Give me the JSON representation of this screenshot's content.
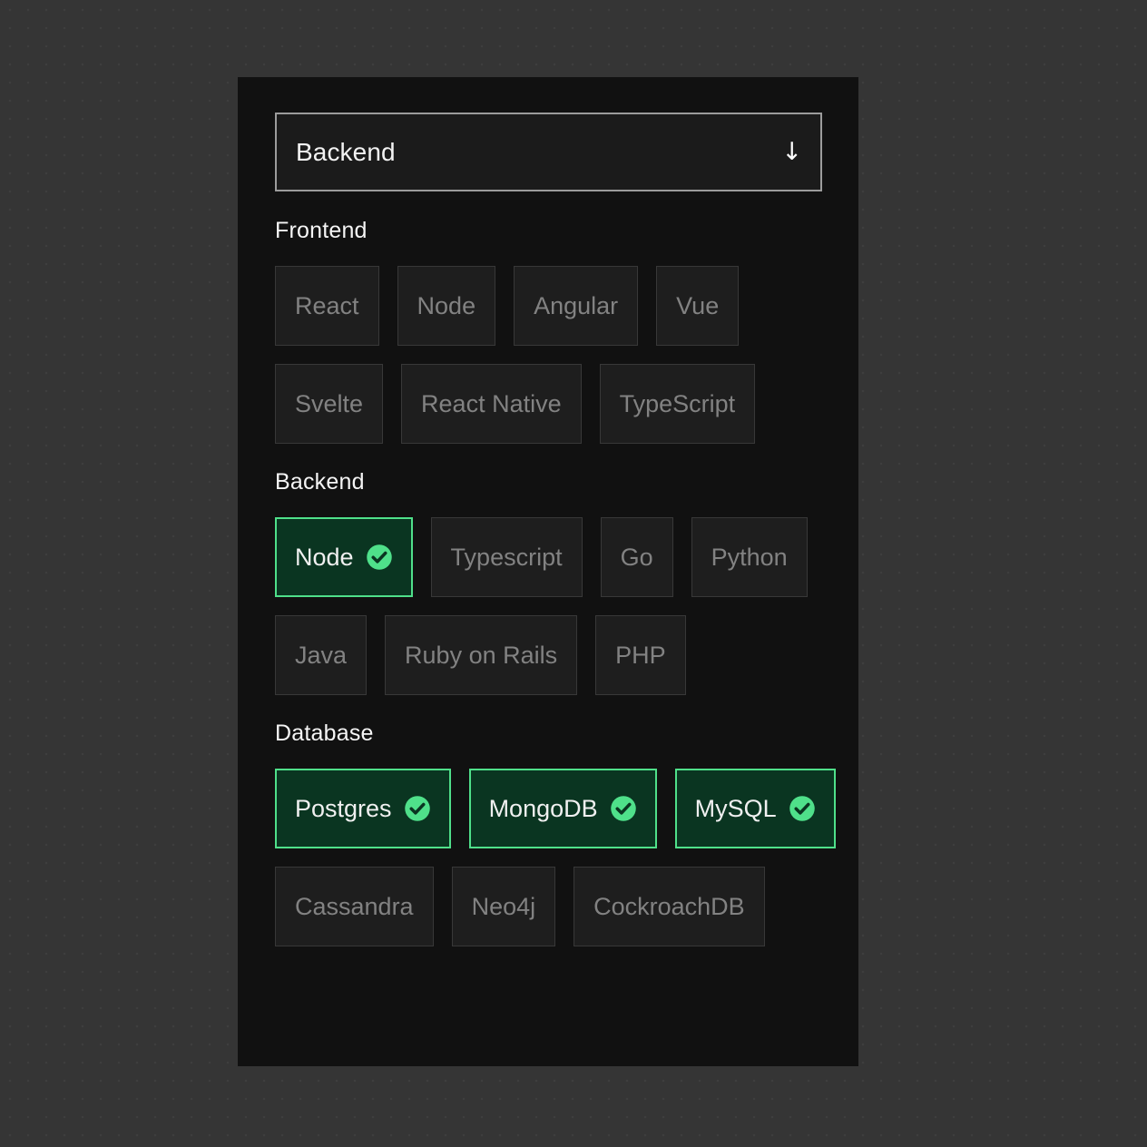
{
  "background": {
    "color": "#353535",
    "dot_color": "#3e3e3e"
  },
  "card": {
    "background": "#111111"
  },
  "colors": {
    "accent_green": "#4fe08a",
    "selected_fill": "#0a3521",
    "chip_idle_fill": "#1e1e1e",
    "chip_idle_border": "#383838",
    "chip_idle_text": "#828282",
    "heading_text": "#f5f5f5",
    "select_border": "#9c9c9c"
  },
  "select": {
    "value": "Backend",
    "arrow_glyph": "↓",
    "options": [
      "Frontend",
      "Backend",
      "Database"
    ]
  },
  "sections": [
    {
      "id": "frontend",
      "title": "Frontend",
      "rows": [
        [
          {
            "label": "React",
            "selected": false
          },
          {
            "label": "Node",
            "selected": false
          },
          {
            "label": "Angular",
            "selected": false
          },
          {
            "label": "Vue",
            "selected": false
          }
        ],
        [
          {
            "label": "Svelte",
            "selected": false
          },
          {
            "label": "React Native",
            "selected": false
          },
          {
            "label": "TypeScript",
            "selected": false
          }
        ]
      ]
    },
    {
      "id": "backend",
      "title": "Backend",
      "rows": [
        [
          {
            "label": "Node",
            "selected": true
          },
          {
            "label": "Typescript",
            "selected": false
          },
          {
            "label": "Go",
            "selected": false
          },
          {
            "label": "Python",
            "selected": false
          }
        ],
        [
          {
            "label": "Java",
            "selected": false
          },
          {
            "label": "Ruby on Rails",
            "selected": false
          },
          {
            "label": "PHP",
            "selected": false
          }
        ]
      ]
    },
    {
      "id": "database",
      "title": "Database",
      "rows": [
        [
          {
            "label": "Postgres",
            "selected": true
          },
          {
            "label": "MongoDB",
            "selected": true
          },
          {
            "label": "MySQL",
            "selected": true
          }
        ],
        [
          {
            "label": "Cassandra",
            "selected": false
          },
          {
            "label": "Neo4j",
            "selected": false
          },
          {
            "label": "CockroachDB",
            "selected": false
          }
        ]
      ]
    }
  ]
}
